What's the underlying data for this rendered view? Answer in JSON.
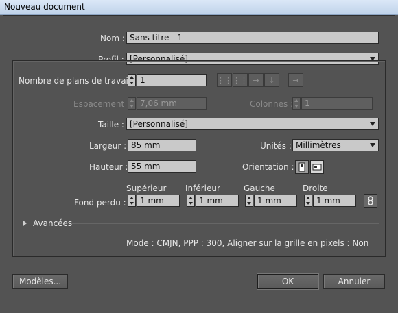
{
  "window": {
    "title": "Nouveau document"
  },
  "name": {
    "label": "Nom :",
    "value": "Sans titre - 1"
  },
  "profile": {
    "label": "Profil :",
    "value": "[Personnalisé]"
  },
  "artboards": {
    "label": "Nombre de plans de travail :",
    "value": "1"
  },
  "spacing": {
    "label": "Espacement :",
    "value": "7,06 mm"
  },
  "columns": {
    "label": "Colonnes :",
    "value": "1"
  },
  "size": {
    "label": "Taille :",
    "value": "[Personnalisé]"
  },
  "width": {
    "label": "Largeur :",
    "value": "85 mm"
  },
  "units": {
    "label": "Unités :",
    "value": "Millimètres"
  },
  "height": {
    "label": "Hauteur :",
    "value": "55 mm"
  },
  "orientation": {
    "label": "Orientation :"
  },
  "bleed": {
    "label": "Fond perdu :",
    "top": {
      "label": "Supérieur",
      "value": "1 mm"
    },
    "bottom": {
      "label": "Inférieur",
      "value": "1 mm"
    },
    "left": {
      "label": "Gauche",
      "value": "1 mm"
    },
    "right": {
      "label": "Droite",
      "value": "1 mm"
    }
  },
  "advanced": {
    "label": "Avancées"
  },
  "summary": "Mode : CMJN, PPP : 300, Aligner sur la grille en pixels : Non",
  "buttons": {
    "templates": "Modèles...",
    "ok": "OK",
    "cancel": "Annuler"
  }
}
